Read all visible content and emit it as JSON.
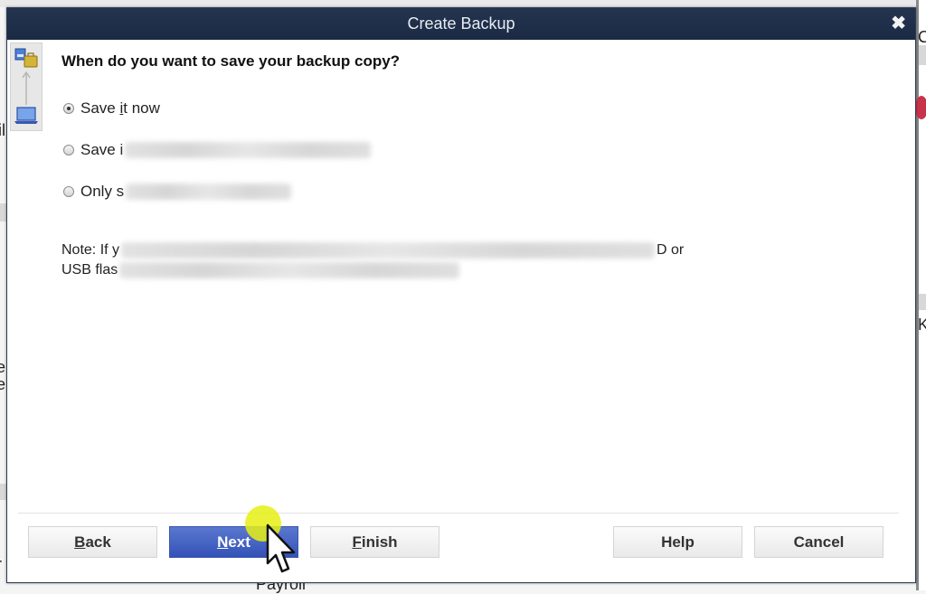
{
  "background": {
    "fragments": {
      "left_top": "il",
      "left_mid1": "e",
      "left_mid2": "e:",
      "left_bottom": "r",
      "right_top": "C",
      "right_mid": "K",
      "bottom_label": "Payroll"
    }
  },
  "dialog": {
    "title": "Create Backup",
    "close_label": "✖",
    "question": "When do you want to save your backup copy?",
    "options": [
      {
        "label": "Save it now",
        "label_visible_prefix": "Save ",
        "accesskey": "i",
        "label_rest": "t now",
        "checked": true,
        "redacted": false
      },
      {
        "label": "Save i",
        "checked": false,
        "redacted": true
      },
      {
        "label": "Only s",
        "checked": false,
        "redacted": true
      }
    ],
    "note": {
      "line1_start": "Note: If y",
      "line1_end": "D or",
      "line2_start": "USB flas"
    },
    "buttons": {
      "back": {
        "pre": "",
        "accesskey": "B",
        "post": "ack"
      },
      "next": {
        "pre": "",
        "accesskey": "N",
        "post": "ext"
      },
      "finish": {
        "pre": "",
        "accesskey": "F",
        "post": "inish"
      },
      "help": "Help",
      "cancel": "Cancel"
    }
  },
  "colors": {
    "titlebar": "#1b2a44",
    "primary_button": "#3452b7",
    "cursor_highlight": "#e6f014"
  }
}
